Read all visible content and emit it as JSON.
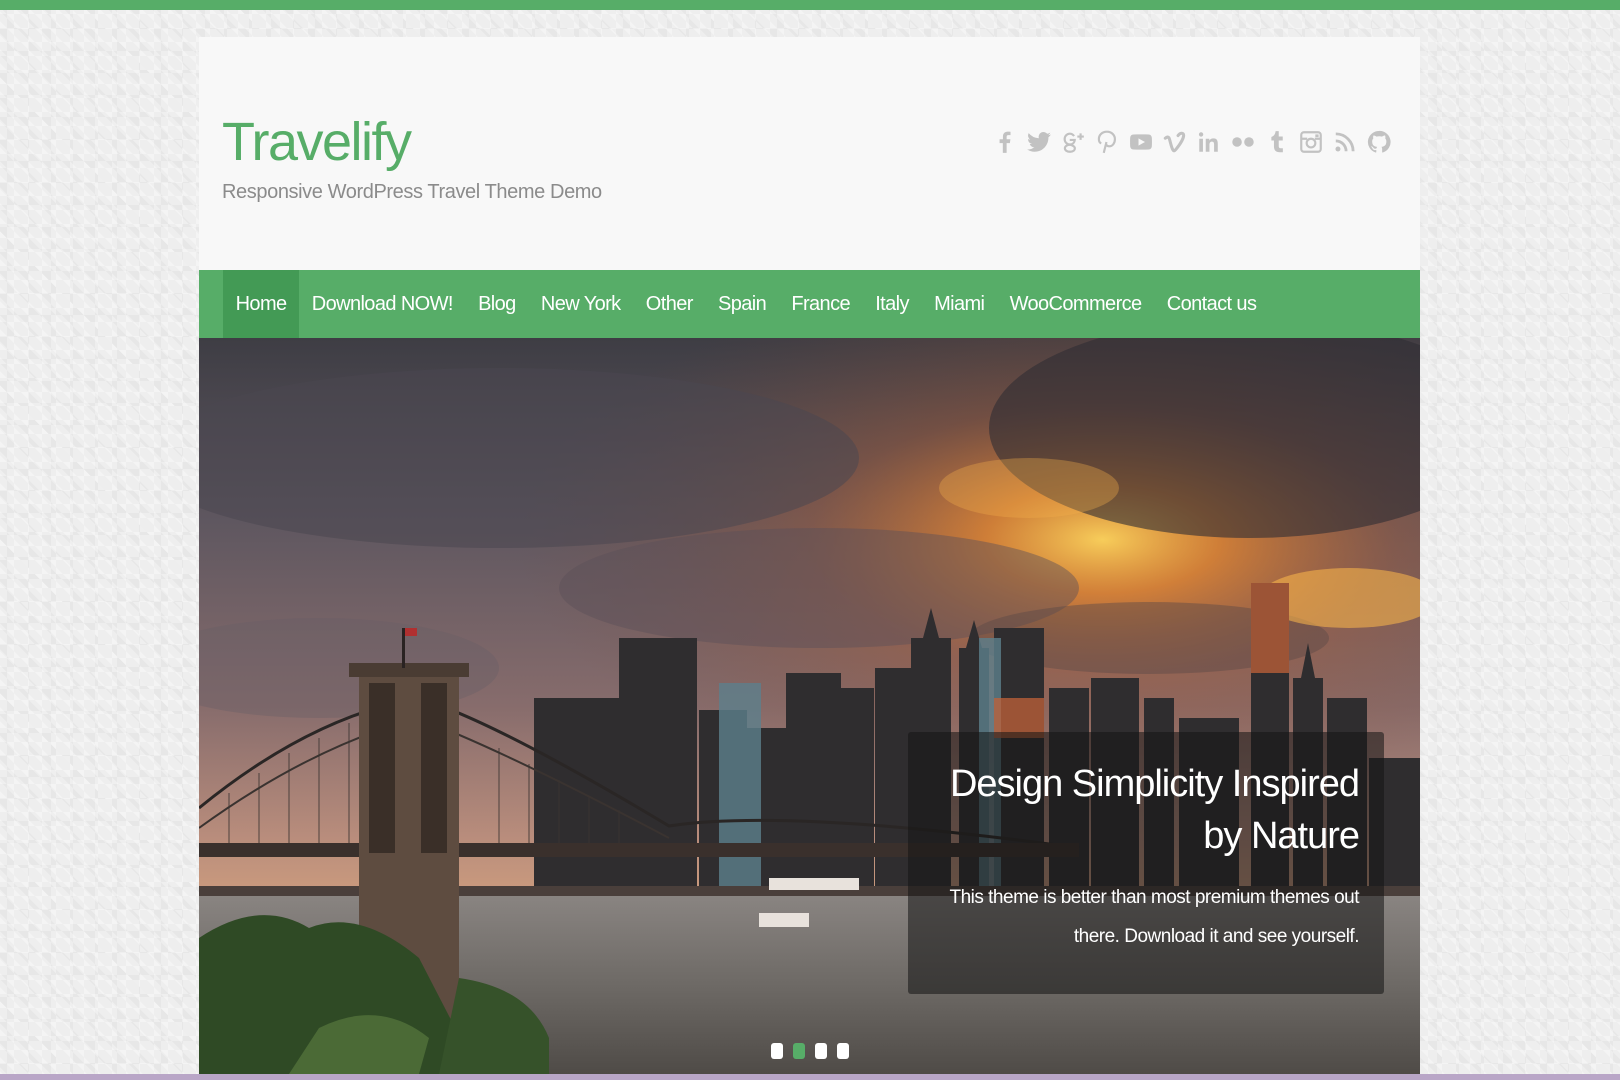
{
  "site": {
    "title": "Travelify",
    "description": "Responsive WordPress Travel Theme Demo"
  },
  "social_icons": [
    "facebook-icon",
    "twitter-icon",
    "google-plus-icon",
    "pinterest-icon",
    "youtube-icon",
    "vimeo-icon",
    "linkedin-icon",
    "flickr-icon",
    "tumblr-icon",
    "instagram-icon",
    "rss-icon",
    "github-icon"
  ],
  "nav": {
    "items": [
      {
        "label": "Home",
        "active": true
      },
      {
        "label": "Download NOW!"
      },
      {
        "label": "Blog"
      },
      {
        "label": "New York"
      },
      {
        "label": "Other"
      },
      {
        "label": "Spain"
      },
      {
        "label": "France"
      },
      {
        "label": "Italy"
      },
      {
        "label": "Miami"
      },
      {
        "label": "WooCommerce"
      },
      {
        "label": "Contact us"
      }
    ]
  },
  "slider": {
    "caption_title": "Design Simplicity Inspired by Nature",
    "caption_text": "This theme is better than most premium themes out there. Download it and see yourself.",
    "slide_count": 4,
    "active_slide": 2
  },
  "colors": {
    "accent": "#57ad68",
    "accent_dark": "#439a55",
    "muted_text": "#8b8b8b",
    "icon_grey": "#c2c2c2"
  }
}
